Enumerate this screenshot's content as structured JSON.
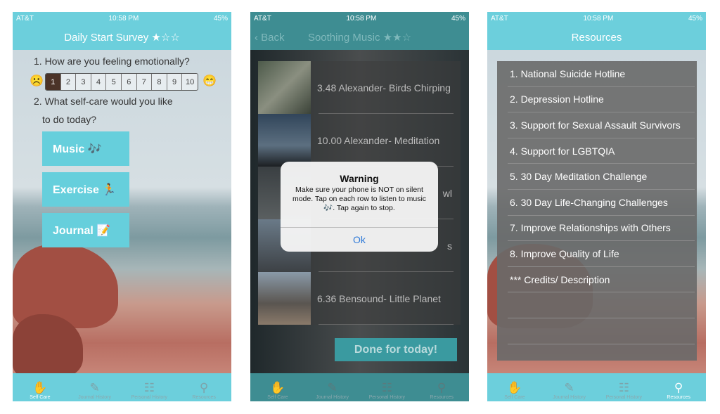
{
  "status": {
    "carrier": "AT&T",
    "time": "10:58 PM",
    "battery": "45%"
  },
  "tabs": [
    "Self Care",
    "Journal History",
    "Personal History",
    "Resources"
  ],
  "survey": {
    "title": "Daily Start Survey ★☆☆",
    "q1": "1. How are you feeling emotionally?",
    "scale": [
      "1",
      "2",
      "3",
      "4",
      "5",
      "6",
      "7",
      "8",
      "9",
      "10"
    ],
    "selected": "1",
    "sad": "☹️",
    "happy": "😁",
    "q2a": "2. What self-care would you like",
    "q2b": "to do today?",
    "buttons": [
      "Music 🎶",
      "Exercise 🏃",
      "Journal 📝"
    ]
  },
  "music": {
    "back": "Back",
    "title": "Soothing Music ★★☆",
    "rows": [
      "3.48 Alexander- Birds Chirping",
      "10.00 Alexander- Meditation",
      "wl",
      "s",
      "6.36 Bensound- Little Planet"
    ],
    "done": "Done for today!",
    "alert": {
      "title": "Warning",
      "message": "Make sure your phone is NOT on silent mode. Tap on each row to listen to music 🎶. Tap again to stop.",
      "ok": "Ok"
    }
  },
  "resources": {
    "title": "Resources",
    "items": [
      "1. National Suicide Hotline",
      "2. Depression Hotline",
      "3. Support for Sexual Assault Survivors",
      "4. Support for LGBTQIA",
      "5. 30 Day Meditation Challenge",
      "6. 30 Day Life-Changing Challenges",
      "7. Improve Relationships with Others",
      "8. Improve Quality of Life",
      "*** Credits/ Description",
      "",
      ""
    ]
  },
  "colors": {
    "accent": "#6ccfdc",
    "music_nav": "#3e8d92",
    "done": "#3a9aa0",
    "alert_link": "#2f7ad8"
  }
}
